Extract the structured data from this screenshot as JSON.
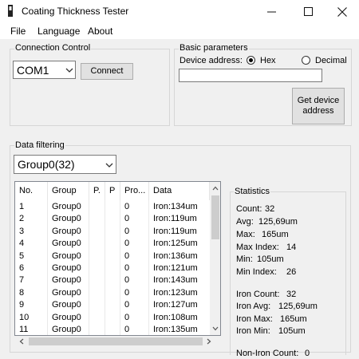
{
  "window": {
    "title": "Coating Thickness Tester",
    "minimize": "—",
    "maximize": "☐",
    "close": "✕"
  },
  "menu": {
    "file": "File",
    "language": "Language",
    "about": "About"
  },
  "connection": {
    "group_label": "Connection Control",
    "port": "COM1",
    "connect_label": "Connect"
  },
  "basic": {
    "group_label": "Basic parameters",
    "device_address_label": "Device address:",
    "hex_label": "Hex",
    "decimal_label": "Decimal",
    "selected": "Hex",
    "address_value": "",
    "get_address_label": "Get device address"
  },
  "filter": {
    "group_label": "Data filtering",
    "selected_group": "Group0(32)"
  },
  "table": {
    "columns": [
      "No.",
      "Group",
      "P.",
      "P",
      "Pro...",
      "Data"
    ],
    "rows": [
      {
        "no": "1",
        "group": "Group0",
        "pro": "0",
        "data": "Iron:134um"
      },
      {
        "no": "2",
        "group": "Group0",
        "pro": "0",
        "data": "Iron:119um"
      },
      {
        "no": "3",
        "group": "Group0",
        "pro": "0",
        "data": "Iron:119um"
      },
      {
        "no": "4",
        "group": "Group0",
        "pro": "0",
        "data": "Iron:125um"
      },
      {
        "no": "5",
        "group": "Group0",
        "pro": "0",
        "data": "Iron:136um"
      },
      {
        "no": "6",
        "group": "Group0",
        "pro": "0",
        "data": "Iron:121um"
      },
      {
        "no": "7",
        "group": "Group0",
        "pro": "0",
        "data": "Iron:143um"
      },
      {
        "no": "8",
        "group": "Group0",
        "pro": "0",
        "data": "Iron:123um"
      },
      {
        "no": "9",
        "group": "Group0",
        "pro": "0",
        "data": "Iron:127um"
      },
      {
        "no": "10",
        "group": "Group0",
        "pro": "0",
        "data": "Iron:108um"
      },
      {
        "no": "11",
        "group": "Group0",
        "pro": "0",
        "data": "Iron:135um"
      }
    ]
  },
  "statistics": {
    "group_label": "Statistics",
    "count": {
      "label": "Count:",
      "value": "32"
    },
    "avg": {
      "label": "Avg:",
      "value": "125,69um"
    },
    "max": {
      "label": "Max:",
      "value": "165um"
    },
    "max_index": {
      "label": "Max Index:",
      "value": "14"
    },
    "min": {
      "label": "Min:",
      "value": "105um"
    },
    "min_index": {
      "label": "Min Index:",
      "value": "26"
    },
    "iron_count": {
      "label": "Iron Count:",
      "value": "32"
    },
    "iron_avg": {
      "label": "Iron Avg:",
      "value": "125,69um"
    },
    "iron_max": {
      "label": "Iron Max:",
      "value": "165um"
    },
    "iron_min": {
      "label": "Iron Min:",
      "value": "105um"
    },
    "non_iron_count": {
      "label": "Non-Iron Count:",
      "value": "0"
    }
  }
}
